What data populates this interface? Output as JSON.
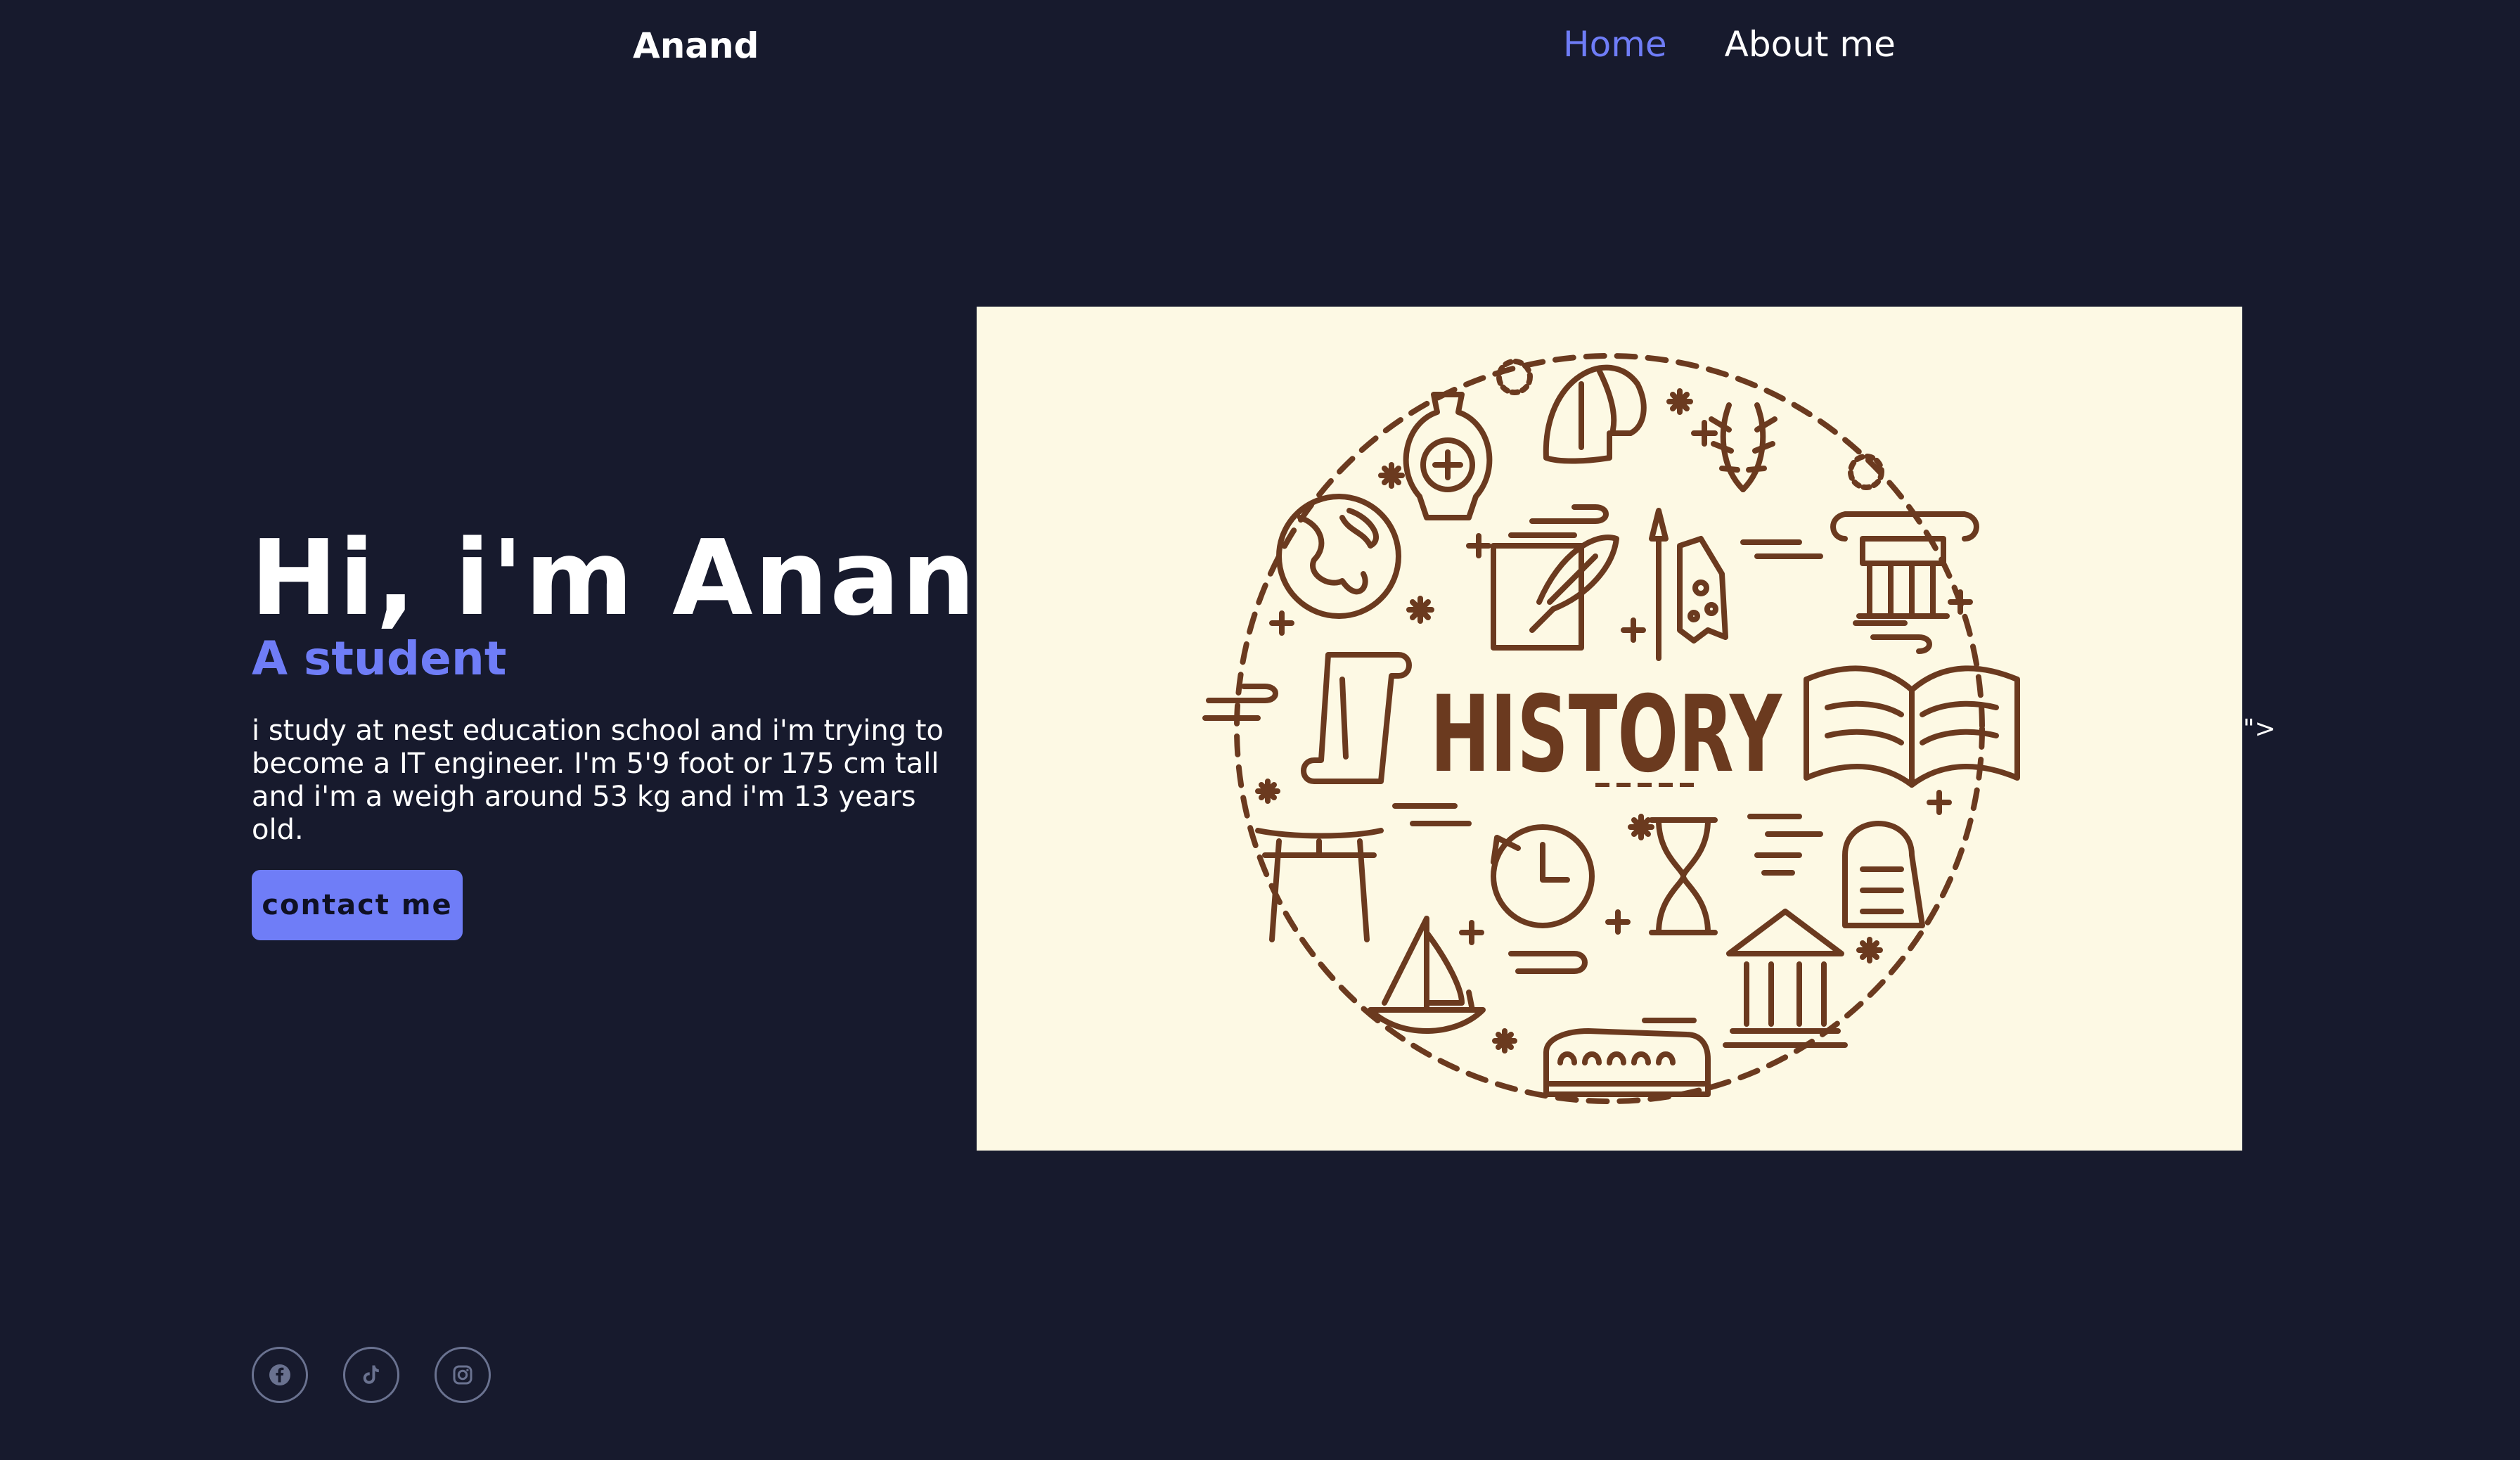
{
  "nav": {
    "brand": "Anand",
    "links": [
      {
        "label": "Home",
        "active": true
      },
      {
        "label": "About me",
        "active": false
      }
    ]
  },
  "hero": {
    "title": "Hi, i'm Anand",
    "subtitle": "A student",
    "description": "i study at nest education school and i'm trying to become a IT engineer. I'm 5'9 foot or 175 cm tall and i'm a weigh around 53 kg and i'm 13 years old.",
    "contact_button": "contact me",
    "stray_text": "\">"
  },
  "image": {
    "main_text": "HISTORY",
    "icon_color": "#6b3a1f",
    "background": "#fdf9e4"
  },
  "socials": [
    {
      "icon": "facebook-icon"
    },
    {
      "icon": "tiktok-icon"
    },
    {
      "icon": "instagram-icon"
    }
  ],
  "colors": {
    "background": "#171a2d",
    "accent": "#6f7df7",
    "text": "#ffffff"
  }
}
